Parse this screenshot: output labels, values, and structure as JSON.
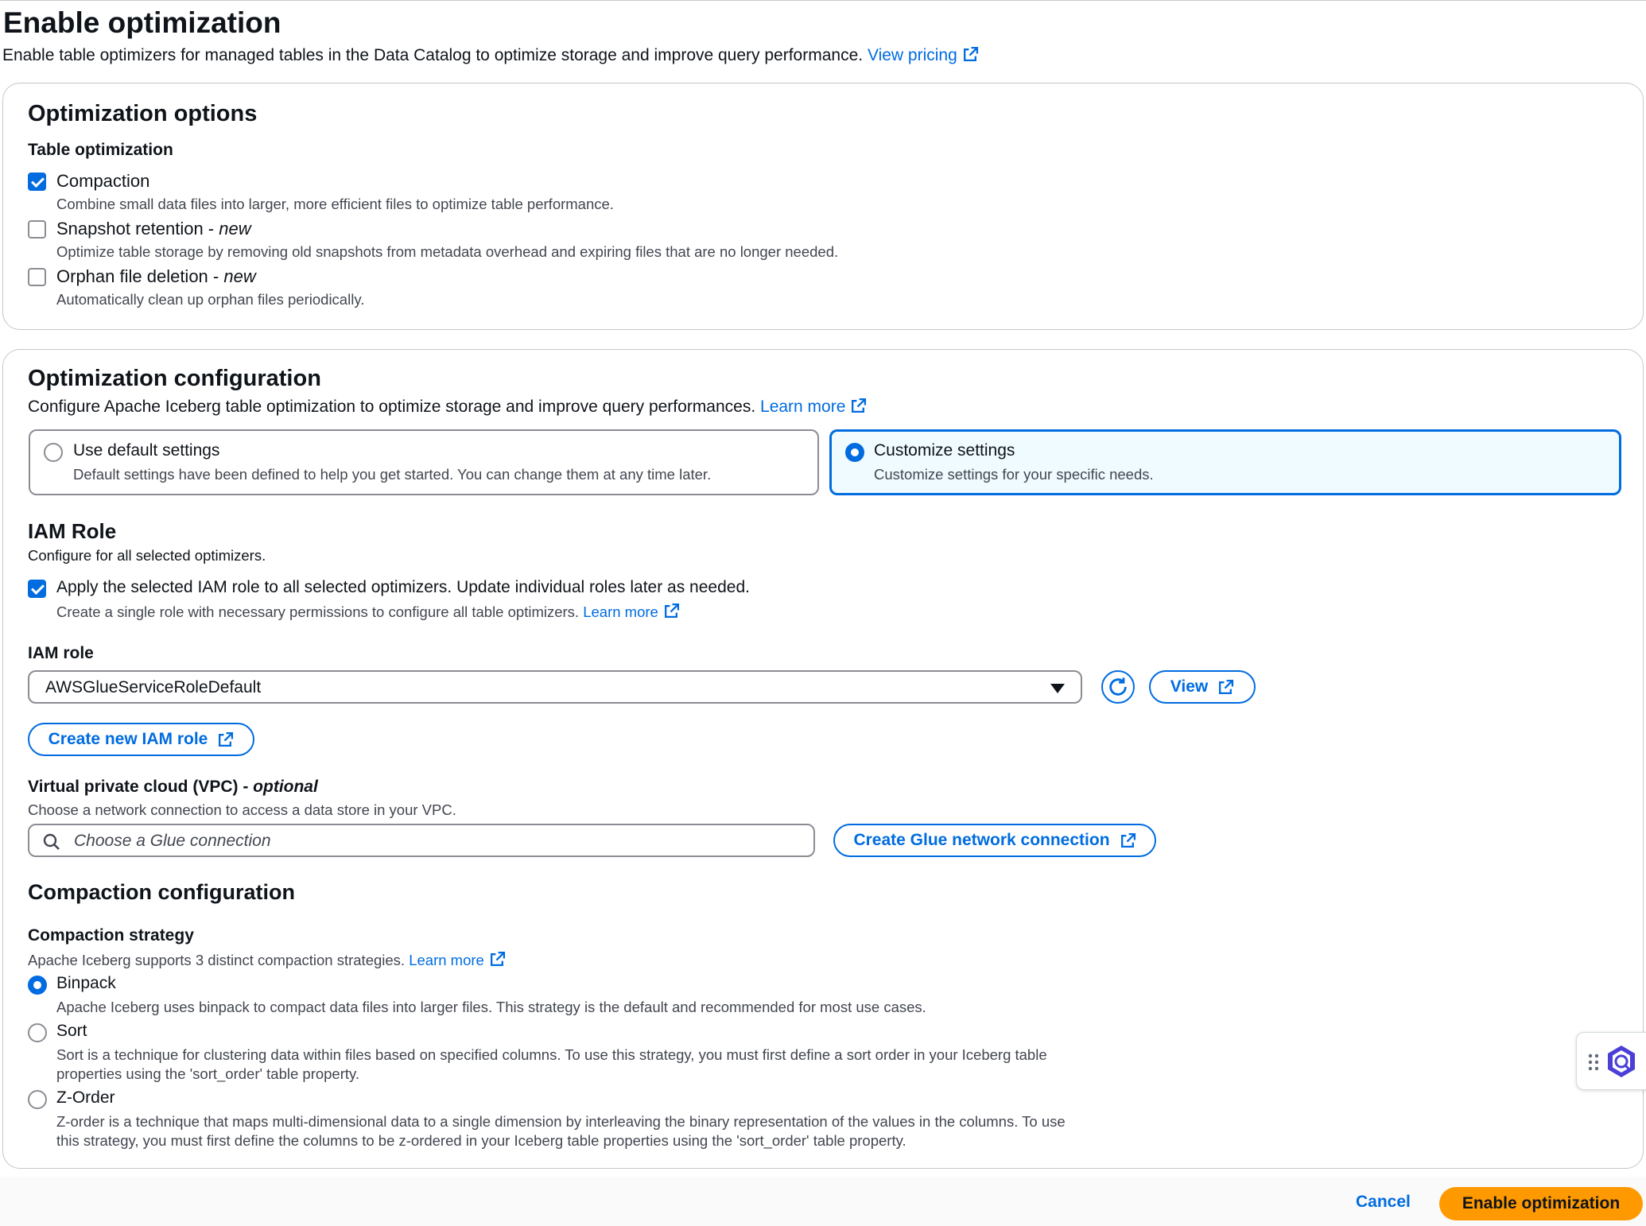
{
  "header": {
    "title": "Enable optimization",
    "description": "Enable table optimizers for managed tables in the Data Catalog to optimize storage and improve query performance.",
    "pricing_link": "View pricing"
  },
  "options": {
    "title": "Optimization options",
    "group_label": "Table optimization",
    "items": [
      {
        "label": "Compaction",
        "suffix": "",
        "description": "Combine small data files into larger, more efficient files to optimize table performance.",
        "checked": true
      },
      {
        "label": "Snapshot retention - ",
        "suffix": "new",
        "description": "Optimize table storage by removing old snapshots from metadata overhead and expiring files that are no longer needed.",
        "checked": false
      },
      {
        "label": "Orphan file deletion - ",
        "suffix": "new",
        "description": "Automatically clean up orphan files periodically.",
        "checked": false
      }
    ]
  },
  "config": {
    "title": "Optimization configuration",
    "description": "Configure Apache Iceberg table optimization to optimize storage and improve query performances.",
    "learn_more": "Learn more",
    "tiles": [
      {
        "label": "Use default settings",
        "description": "Default settings have been defined to help you get started. You can change them at any time later.",
        "selected": false
      },
      {
        "label": "Customize settings",
        "description": "Customize settings for your specific needs.",
        "selected": true
      }
    ],
    "iam": {
      "title": "IAM Role",
      "subtitle": "Configure for all selected optimizers.",
      "apply_label": "Apply the selected IAM role to all selected optimizers. Update individual roles later as needed.",
      "apply_description": "Create a single role with necessary permissions to configure all table optimizers.",
      "apply_learn_more": "Learn more",
      "apply_checked": true,
      "field_label": "IAM role",
      "selected_role": "AWSGlueServiceRoleDefault",
      "view_label": "View",
      "create_label": "Create new IAM role"
    },
    "vpc": {
      "label": "Virtual private cloud (VPC) - ",
      "label_suffix": "optional",
      "description": "Choose a network connection to access a data store in your VPC.",
      "placeholder": "Choose a Glue connection",
      "create_label": "Create Glue network connection"
    },
    "compaction": {
      "title": "Compaction configuration",
      "strategy_label": "Compaction strategy",
      "strategy_description": "Apache Iceberg supports 3 distinct compaction strategies.",
      "learn_more": "Learn more",
      "strategies": [
        {
          "label": "Binpack",
          "description": "Apache Iceberg uses binpack to compact data files into larger files. This strategy is the default and recommended for most use cases.",
          "description2": "",
          "selected": true
        },
        {
          "label": "Sort",
          "description": "Sort is a technique for clustering data within files based on specified columns. To use this strategy, you must first define a sort order in your Iceberg table",
          "description2": "properties using the 'sort_order' table property.",
          "selected": false
        },
        {
          "label": "Z-Order",
          "description": "Z-order is a technique that maps multi-dimensional data to a single dimension by interleaving the binary representation of the values in the columns. To use",
          "description2": "this strategy, you must first define the columns to be z-ordered in your Iceberg table properties using the 'sort_order' table property.",
          "selected": false
        }
      ]
    }
  },
  "footer": {
    "cancel_label": "Cancel",
    "submit_label": "Enable optimization"
  },
  "colors": {
    "accent": "#006ce0",
    "primary_button": "#ff9900",
    "border": "#8c8c94"
  }
}
